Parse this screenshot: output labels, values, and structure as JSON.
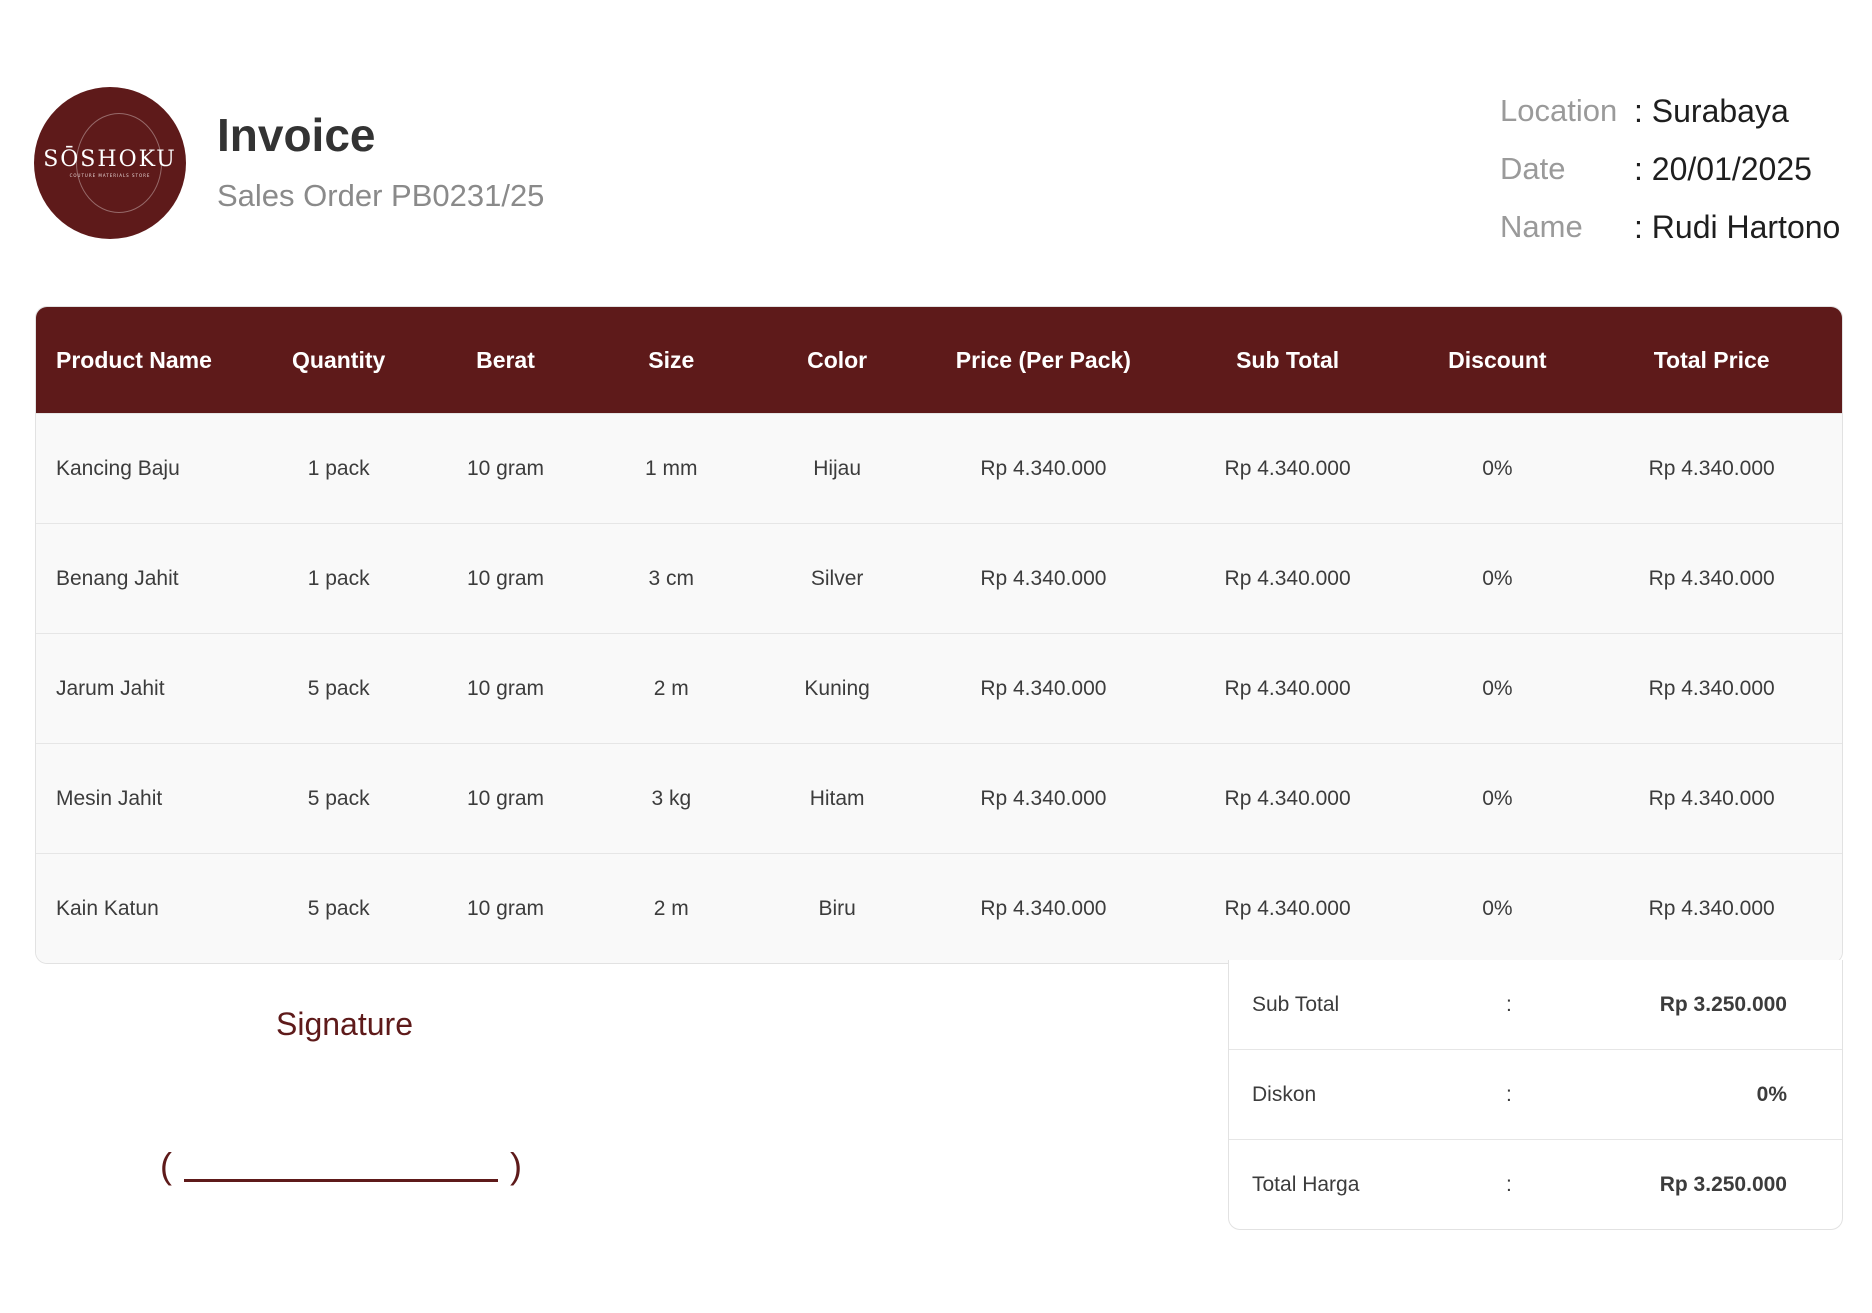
{
  "logo": {
    "name": "SŌSHOKU",
    "tagline": "COUTURE MATERIALS STORE"
  },
  "header": {
    "title": "Invoice",
    "subtitle": "Sales Order PB0231/25"
  },
  "meta": {
    "location_label": "Location",
    "location_value": ": Surabaya",
    "date_label": "Date",
    "date_value": ": 20/01/2025",
    "name_label": "Name",
    "name_value": ": Rudi Hartono"
  },
  "table": {
    "headers": [
      "Product Name",
      "Quantity",
      "Berat",
      "Size",
      "Color",
      "Price (Per Pack)",
      "Sub Total",
      "Discount",
      "Total Price"
    ],
    "rows": [
      [
        "Kancing Baju",
        "1 pack",
        "10 gram",
        "1 mm",
        "Hijau",
        "Rp 4.340.000",
        "Rp 4.340.000",
        "0%",
        "Rp 4.340.000"
      ],
      [
        "Benang Jahit",
        "1 pack",
        "10 gram",
        "3 cm",
        "Silver",
        "Rp 4.340.000",
        "Rp 4.340.000",
        "0%",
        "Rp 4.340.000"
      ],
      [
        "Jarum Jahit",
        "5 pack",
        "10 gram",
        "2 m",
        "Kuning",
        "Rp 4.340.000",
        "Rp 4.340.000",
        "0%",
        "Rp 4.340.000"
      ],
      [
        "Mesin Jahit",
        "5 pack",
        "10 gram",
        "3 kg",
        "Hitam",
        "Rp 4.340.000",
        "Rp 4.340.000",
        "0%",
        "Rp 4.340.000"
      ],
      [
        "Kain Katun",
        "5 pack",
        "10 gram",
        "2 m",
        "Biru",
        "Rp 4.340.000",
        "Rp 4.340.000",
        "0%",
        "Rp 4.340.000"
      ]
    ]
  },
  "signature": {
    "title": "Signature",
    "open_paren": "(",
    "close_paren": ")"
  },
  "totals": [
    {
      "label": "Sub Total",
      "colon": ":",
      "value": "Rp 3.250.000"
    },
    {
      "label": "Diskon",
      "colon": ":",
      "value": "0%"
    },
    {
      "label": "Total Harga",
      "colon": ":",
      "value": "Rp 3.250.000"
    }
  ],
  "colors": {
    "accent": "#5e1a1a",
    "row_background": "#f9f9f9",
    "muted_text": "#8a8a8a"
  }
}
